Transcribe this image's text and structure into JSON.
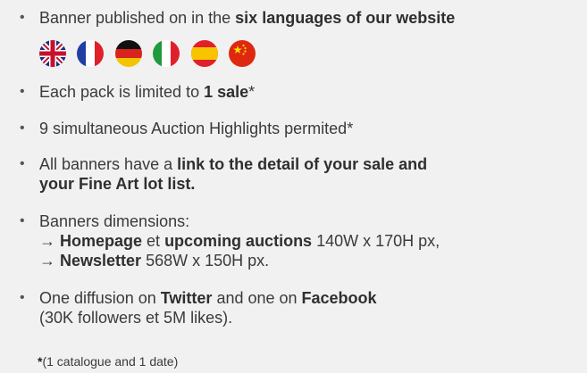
{
  "bullet_symbol": "•",
  "items": [
    {
      "id": "languages",
      "lines": [
        {
          "parts": [
            {
              "t": "Banner published on in the ",
              "b": false
            },
            {
              "t": "six languages of our website",
              "b": true
            }
          ]
        }
      ]
    },
    {
      "id": "sale-limit",
      "lines": [
        {
          "parts": [
            {
              "t": "Each pack is limited to ",
              "b": false
            },
            {
              "t": "1 sale",
              "b": true
            },
            {
              "t": "*",
              "b": false
            }
          ]
        }
      ]
    },
    {
      "id": "highlights",
      "lines": [
        {
          "parts": [
            {
              "t": "9 simultaneous Auction Highlights permited*",
              "b": false
            }
          ]
        }
      ]
    },
    {
      "id": "links",
      "lines": [
        {
          "parts": [
            {
              "t": "All banners have a ",
              "b": false
            },
            {
              "t": "link to the detail of your sale and",
              "b": true
            }
          ]
        },
        {
          "parts": [
            {
              "t": "your Fine Art lot list.",
              "b": true
            }
          ]
        }
      ]
    },
    {
      "id": "dimensions",
      "lines": [
        {
          "parts": [
            {
              "t": "Banners dimensions:",
              "b": false
            }
          ]
        },
        {
          "parts": [
            {
              "t": "→ ",
              "b": false
            },
            {
              "t": "Homepage",
              "b": true
            },
            {
              "t": " et ",
              "b": false
            },
            {
              "t": "upcoming auctions",
              "b": true
            },
            {
              "t": " 140W x 170H px,",
              "b": false
            }
          ]
        },
        {
          "parts": [
            {
              "t": "→ ",
              "b": false
            },
            {
              "t": "Newsletter",
              "b": true
            },
            {
              "t": " 568W x 150H px.",
              "b": false
            }
          ]
        }
      ]
    },
    {
      "id": "social",
      "lines": [
        {
          "parts": [
            {
              "t": "One diffusion on ",
              "b": false
            },
            {
              "t": "Twitter",
              "b": true
            },
            {
              "t": " and one on ",
              "b": false
            },
            {
              "t": "Facebook",
              "b": true
            }
          ]
        },
        {
          "parts": [
            {
              "t": "(30K followers et 5M likes).",
              "b": false
            }
          ]
        }
      ]
    }
  ],
  "flags": [
    {
      "icon": "uk-flag-icon"
    },
    {
      "icon": "france-flag-icon"
    },
    {
      "icon": "germany-flag-icon"
    },
    {
      "icon": "italy-flag-icon"
    },
    {
      "icon": "spain-flag-icon"
    },
    {
      "icon": "china-flag-icon"
    }
  ],
  "footnote": {
    "star": "*",
    "text": "(1 catalogue and 1 date)"
  }
}
